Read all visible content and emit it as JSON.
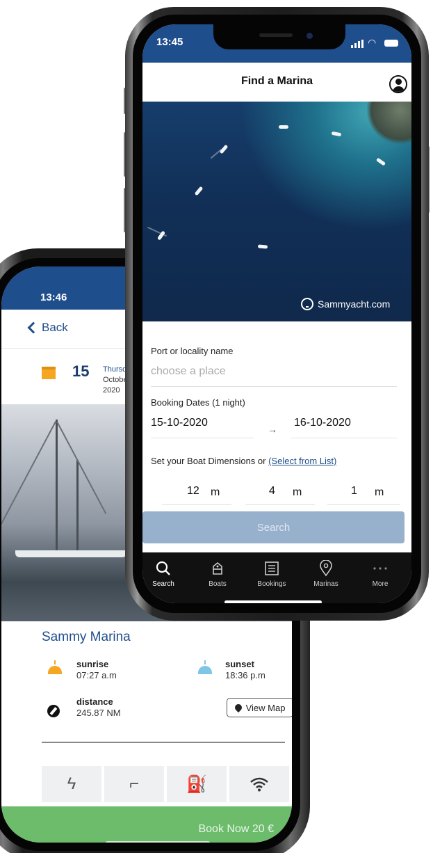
{
  "back_phone": {
    "status_time": "13:46",
    "back_label": "Back",
    "date": {
      "day": "15",
      "weekday": "Thursd",
      "month": "Octobe",
      "year": "2020"
    },
    "marina_name": "Sammy Marina",
    "sunrise": {
      "label": "sunrise",
      "value": "07:27 a.m"
    },
    "sunset": {
      "label": "sunset",
      "value": "18:36 p.m"
    },
    "distance": {
      "label": "distance",
      "value": "245.87 NM"
    },
    "view_map_label": "View Map",
    "amenities": [
      "electricity-icon",
      "water-tap-icon",
      "fuel-pump-icon",
      "wifi-icon"
    ],
    "book_now_label": "Book Now 20 €",
    "colors": {
      "status_bar": "#1f4e8c",
      "book_button": "#6cbc6c"
    }
  },
  "front_phone": {
    "status_time": "13:45",
    "header_title": "Find a Marina",
    "hero_watermark": "Sammyacht.com",
    "port_label": "Port or locality name",
    "port_placeholder": "choose a place",
    "dates_label": "Booking Dates (1 night)",
    "date_from": "15-10-2020",
    "date_arrow": "→",
    "date_to": "16-10-2020",
    "dimensions_label": "Set your Boat Dimensions or",
    "select_from_list": "(Select from List)",
    "dimensions": [
      {
        "value": "12",
        "unit": "m"
      },
      {
        "value": "4",
        "unit": "m"
      },
      {
        "value": "1",
        "unit": "m"
      }
    ],
    "search_button": "Search",
    "tabs": [
      {
        "label": "Search",
        "icon": "search-icon"
      },
      {
        "label": "Boats",
        "icon": "boat-icon"
      },
      {
        "label": "Bookings",
        "icon": "list-icon"
      },
      {
        "label": "Marinas",
        "icon": "map-pin-icon"
      },
      {
        "label": "More",
        "icon": "more-dots-icon"
      }
    ],
    "colors": {
      "status_bar": "#1f4e8c",
      "search_button": "#97b0cc",
      "tab_bar": "#111111",
      "link": "#1f4e8c"
    }
  }
}
